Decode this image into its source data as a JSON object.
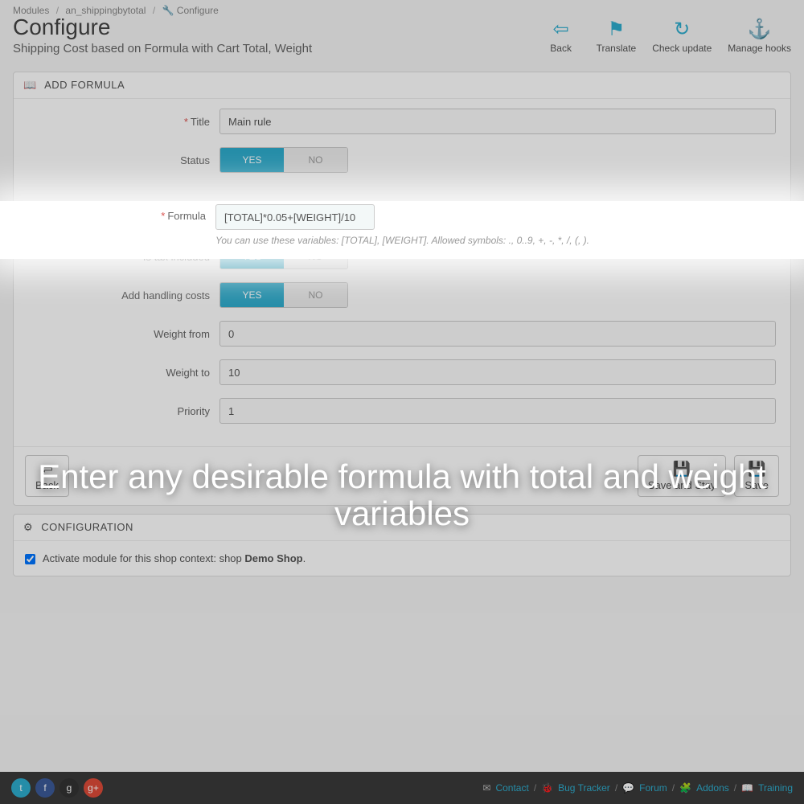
{
  "breadcrumb": {
    "modules": "Modules",
    "module_name": "an_shippingbytotal",
    "current": "Configure"
  },
  "header": {
    "title": "Configure",
    "subtitle": "Shipping Cost based on Formula with Cart Total, Weight",
    "actions": {
      "back": "Back",
      "translate": "Translate",
      "check_update": "Check update",
      "manage_hooks": "Manage hooks"
    }
  },
  "panel_add": {
    "heading": "ADD FORMULA",
    "labels": {
      "title": "Title",
      "status": "Status",
      "formula": "Formula",
      "is_tax": "Is tax included",
      "handling": "Add handling costs",
      "weight_from": "Weight from",
      "weight_to": "Weight to",
      "priority": "Priority"
    },
    "values": {
      "title": "Main rule",
      "formula": "[TOTAL]*0.05+[WEIGHT]/10",
      "weight_from": "0",
      "weight_to": "10",
      "priority": "1"
    },
    "toggle": {
      "yes": "YES",
      "no": "NO"
    },
    "help_formula": "You can use these variables: [TOTAL], [WEIGHT]. Allowed symbols: ., 0..9, +, -, *, /, (, ).",
    "footer": {
      "back": "Back",
      "save_stay": "Save and Stay",
      "save": "Save"
    }
  },
  "panel_config": {
    "heading": "CONFIGURATION",
    "activate_prefix": "Activate module for this shop context: shop ",
    "shop_name": "Demo Shop"
  },
  "footer": {
    "contact": "Contact",
    "bug": "Bug Tracker",
    "forum": "Forum",
    "addons": "Addons",
    "training": "Training"
  },
  "caption": "Enter any desirable formula with total and weight variables"
}
